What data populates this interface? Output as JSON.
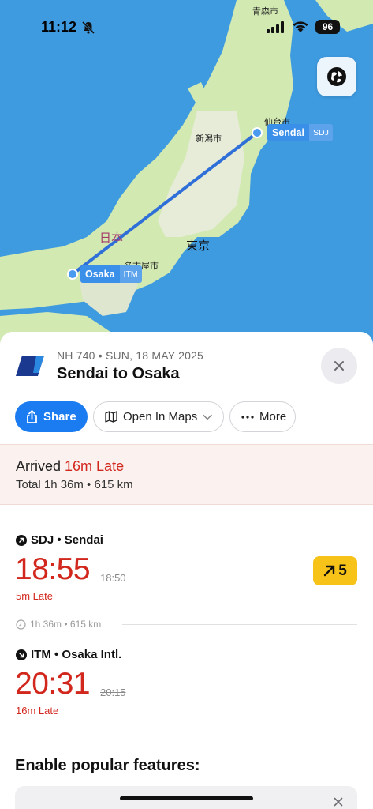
{
  "status_bar": {
    "time": "11:12",
    "battery": "96",
    "icons": [
      "bell-slash-icon",
      "cellular-signal-icon",
      "wifi-icon",
      "battery-icon"
    ]
  },
  "map": {
    "labels": {
      "aomori": "青森市",
      "sendai_city": "仙台市",
      "niigata": "新潟市",
      "japan": "日本",
      "tokyo": "東京",
      "nagoya": "名古屋市"
    },
    "origin_tag": {
      "name": "Sendai",
      "code": "SDJ"
    },
    "destination_tag": {
      "name": "Osaka",
      "code": "ITM"
    },
    "globe_button_icon": "globe-icon",
    "colors": {
      "water": "#3f9be0",
      "land": "#cfe8b0",
      "route": "#2f6fd8"
    }
  },
  "flight": {
    "meta": "NH 740 • SUN, 18 MAY 2025",
    "title": "Sendai to Osaka"
  },
  "actions": {
    "share": "Share",
    "open_in_maps": "Open In Maps",
    "more": "More"
  },
  "summary": {
    "arrived": "Arrived",
    "late": "16m Late",
    "total": "Total 1h 36m • 615 km"
  },
  "departure": {
    "header": "SDJ • Sendai",
    "actual_time": "18:55",
    "scheduled_time": "18:50",
    "delay": "5m Late",
    "gate": "5"
  },
  "duration": "1h 36m • 615 km",
  "arrival": {
    "header": "ITM • Osaka Intl.",
    "actual_time": "20:31",
    "scheduled_time": "20:15",
    "delay": "16m Late"
  },
  "features": {
    "title": "Enable popular features:"
  },
  "colors": {
    "accent": "#1a7cf0",
    "late": "#d2271d",
    "gate": "#f7c319"
  }
}
